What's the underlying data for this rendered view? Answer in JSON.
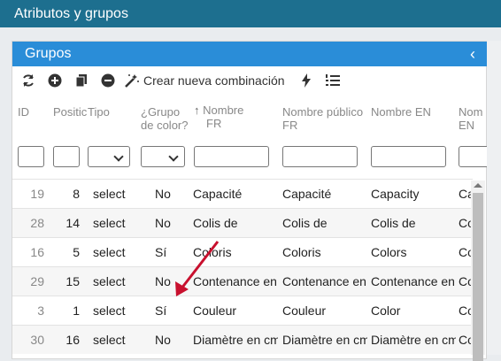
{
  "app": {
    "title": "Atributos y grupos"
  },
  "panel": {
    "title": "Grupos",
    "collapse_glyph": "‹"
  },
  "toolbar": {
    "icons": [
      "refresh-icon",
      "add-icon",
      "copy-icon",
      "remove-icon",
      "magic-wand-icon",
      "flash-icon",
      "ordered-list-icon"
    ],
    "new_combination_label": "Crear nueva combinación"
  },
  "columns": {
    "id": "ID",
    "position": "Positic",
    "type": "Tipo",
    "color_group_1": "¿Grupo",
    "color_group_2": "de color?",
    "name_fr_1": "Nombre",
    "name_fr_2": "FR",
    "public_fr_1": "Nombre público",
    "public_fr_2": "FR",
    "name_en_1": "Nombre EN",
    "name_en_next_1": "Nom",
    "name_en_next_2": "EN"
  },
  "rows": [
    {
      "id": "19",
      "pos": "8",
      "type": "select",
      "color": "No",
      "name_fr": "Capacité",
      "public_fr": "Capacité",
      "name_en": "Capacity",
      "cut": "Ca"
    },
    {
      "id": "28",
      "pos": "14",
      "type": "select",
      "color": "No",
      "name_fr": "Colis de",
      "public_fr": "Colis de",
      "name_en": "Colis de",
      "cut": "Co"
    },
    {
      "id": "16",
      "pos": "5",
      "type": "select",
      "color": "Sí",
      "name_fr": "Coloris",
      "public_fr": "Coloris",
      "name_en": "Colors",
      "cut": "Co"
    },
    {
      "id": "29",
      "pos": "15",
      "type": "select",
      "color": "No",
      "name_fr": "Contenance en",
      "public_fr": "Contenance en",
      "name_en": "Contenance en",
      "cut": "Co"
    },
    {
      "id": "3",
      "pos": "1",
      "type": "select",
      "color": "Sí",
      "name_fr": "Couleur",
      "public_fr": "Couleur",
      "name_en": "Color",
      "cut": "Co"
    },
    {
      "id": "30",
      "pos": "16",
      "type": "select",
      "color": "No",
      "name_fr": "Diamètre en cm",
      "public_fr": "Diamètre en cm",
      "name_en": "Diamètre en cm",
      "cut": "Co"
    }
  ],
  "colors": {
    "topbar": "#1d6f8f",
    "panel_header": "#2a8dd8",
    "arrow": "#c8102e"
  }
}
